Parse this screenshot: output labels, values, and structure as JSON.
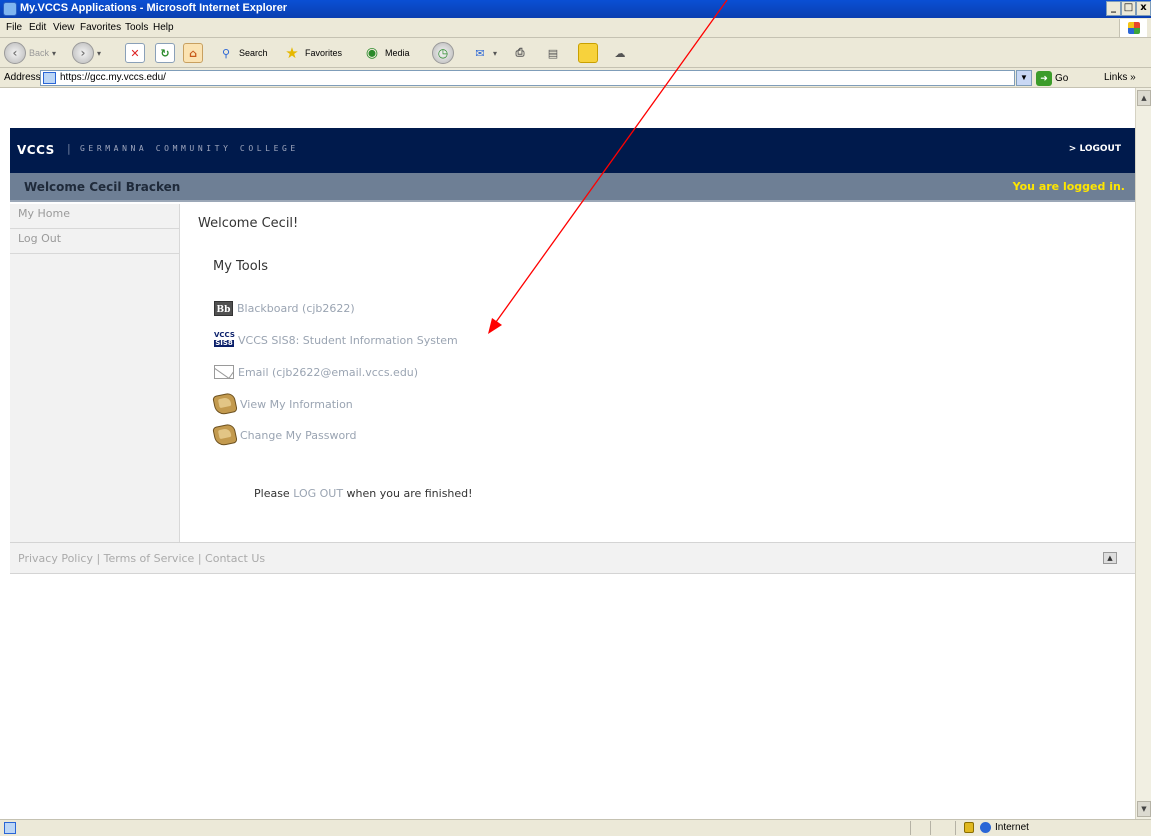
{
  "window": {
    "title": "My.VCCS Applications - Microsoft Internet Explorer",
    "controls": {
      "minimize": "_",
      "restore": "□",
      "close": "x"
    }
  },
  "menubar": {
    "items": [
      "File",
      "Edit",
      "View",
      "Favorites",
      "Tools",
      "Help"
    ]
  },
  "toolbar": {
    "back_label": "Back",
    "search_label": "Search",
    "favorites_label": "Favorites",
    "media_label": "Media"
  },
  "addressbar": {
    "label": "Address",
    "url": "https://gcc.my.vccs.edu/",
    "go_label": "Go",
    "links_label": "Links »"
  },
  "page": {
    "brand": "VCCS",
    "college": "GERMANNA COMMUNITY COLLEGE",
    "logout": "> LOGOUT",
    "welcome_user": "Welcome Cecil Bracken",
    "login_status": "You are logged in.",
    "sidebar": [
      "My Home",
      "Log Out"
    ],
    "greeting": "Welcome Cecil!",
    "tools_heading": "My Tools",
    "tools": [
      {
        "icon": "bb-icon",
        "label": "Blackboard (cjb2622)"
      },
      {
        "icon": "vccs-sis-icon",
        "label": "VCCS SIS8: Student Information System"
      },
      {
        "icon": "envelope-icon",
        "label": "Email (cjb2622@email.vccs.edu)"
      },
      {
        "icon": "folder-icon",
        "label": "View My Information"
      },
      {
        "icon": "folder-icon",
        "label": "Change My Password"
      }
    ],
    "vccs_icon_text": {
      "top": "VCCS",
      "bottom": "SIS8"
    },
    "bb_icon_text": "Bb",
    "finish": {
      "before": "Please ",
      "link": "LOG OUT",
      "after": " when you are finished!"
    },
    "footer": {
      "privacy": "Privacy Policy",
      "terms": "Terms of Service",
      "contact": "Contact Us",
      "separator": " | "
    }
  },
  "statusbar": {
    "zone": "Internet"
  },
  "colors": {
    "banner": "#001a4c",
    "welcome_bar": "#6e7f95",
    "logged_in": "#ffe600",
    "link": "#9aa4b2",
    "annotation_arrow": "#ff0000"
  }
}
